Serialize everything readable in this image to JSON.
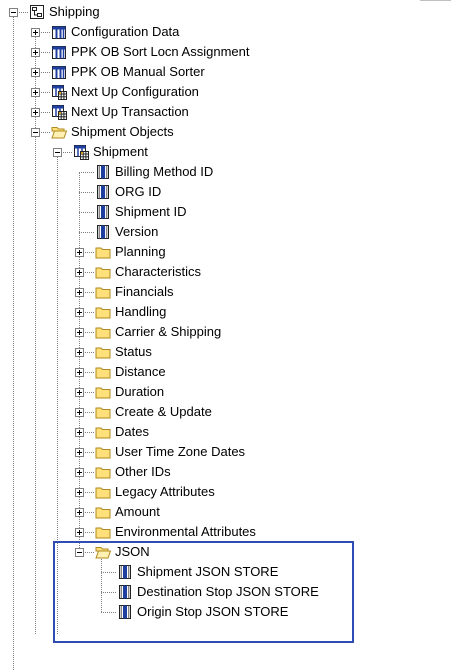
{
  "tree": {
    "nodes": [
      {
        "label": "Shipping",
        "depth": 0,
        "icon": "node-table-icon",
        "expander": "minus"
      },
      {
        "label": "Configuration Data",
        "depth": 1,
        "icon": "table-icon",
        "expander": "plus"
      },
      {
        "label": "PPK OB Sort Locn Assignment",
        "depth": 1,
        "icon": "table-icon",
        "expander": "plus"
      },
      {
        "label": "PPK OB Manual Sorter",
        "depth": 1,
        "icon": "table-icon",
        "expander": "plus"
      },
      {
        "label": "Next Up Configuration",
        "depth": 1,
        "icon": "table-grid-icon",
        "expander": "plus"
      },
      {
        "label": "Next Up Transaction",
        "depth": 1,
        "icon": "table-grid-icon",
        "expander": "plus"
      },
      {
        "label": "Shipment Objects",
        "depth": 1,
        "icon": "open-folder-icon",
        "expander": "minus"
      },
      {
        "label": "Shipment",
        "depth": 2,
        "icon": "table-grid-icon",
        "expander": "minus"
      },
      {
        "label": "Billing Method ID",
        "depth": 3,
        "icon": "column-icon",
        "expander": "none"
      },
      {
        "label": "ORG ID",
        "depth": 3,
        "icon": "column-icon",
        "expander": "none"
      },
      {
        "label": "Shipment ID",
        "depth": 3,
        "icon": "column-icon",
        "expander": "none"
      },
      {
        "label": "Version",
        "depth": 3,
        "icon": "column-icon",
        "expander": "none"
      },
      {
        "label": "Planning",
        "depth": 3,
        "icon": "folder-icon",
        "expander": "plus"
      },
      {
        "label": "Characteristics",
        "depth": 3,
        "icon": "folder-icon",
        "expander": "plus"
      },
      {
        "label": "Financials",
        "depth": 3,
        "icon": "folder-icon",
        "expander": "plus"
      },
      {
        "label": "Handling",
        "depth": 3,
        "icon": "folder-icon",
        "expander": "plus"
      },
      {
        "label": "Carrier & Shipping",
        "depth": 3,
        "icon": "folder-icon",
        "expander": "plus"
      },
      {
        "label": "Status",
        "depth": 3,
        "icon": "folder-icon",
        "expander": "plus"
      },
      {
        "label": "Distance",
        "depth": 3,
        "icon": "folder-icon",
        "expander": "plus"
      },
      {
        "label": "Duration",
        "depth": 3,
        "icon": "folder-icon",
        "expander": "plus"
      },
      {
        "label": "Create & Update",
        "depth": 3,
        "icon": "folder-icon",
        "expander": "plus"
      },
      {
        "label": "Dates",
        "depth": 3,
        "icon": "folder-icon",
        "expander": "plus"
      },
      {
        "label": "User Time Zone Dates",
        "depth": 3,
        "icon": "folder-icon",
        "expander": "plus"
      },
      {
        "label": "Other IDs",
        "depth": 3,
        "icon": "folder-icon",
        "expander": "plus"
      },
      {
        "label": "Legacy Attributes",
        "depth": 3,
        "icon": "folder-icon",
        "expander": "plus"
      },
      {
        "label": "Amount",
        "depth": 3,
        "icon": "folder-icon",
        "expander": "plus"
      },
      {
        "label": "Environmental Attributes",
        "depth": 3,
        "icon": "folder-icon",
        "expander": "plus"
      },
      {
        "label": "JSON",
        "depth": 3,
        "icon": "open-folder-icon",
        "expander": "minus"
      },
      {
        "label": "Shipment JSON STORE",
        "depth": 4,
        "icon": "column-icon",
        "expander": "none"
      },
      {
        "label": "Destination Stop JSON STORE",
        "depth": 4,
        "icon": "column-icon",
        "expander": "none"
      },
      {
        "label": "Origin Stop JSON STORE",
        "depth": 4,
        "icon": "column-icon",
        "expander": "none"
      }
    ]
  },
  "colors": {
    "highlight_border": "#2e4db3",
    "folder_fill": "#ffe07a",
    "folder_stroke": "#b08a1e",
    "table_blue": "#1f3fa0",
    "tree_line": "#808080"
  }
}
